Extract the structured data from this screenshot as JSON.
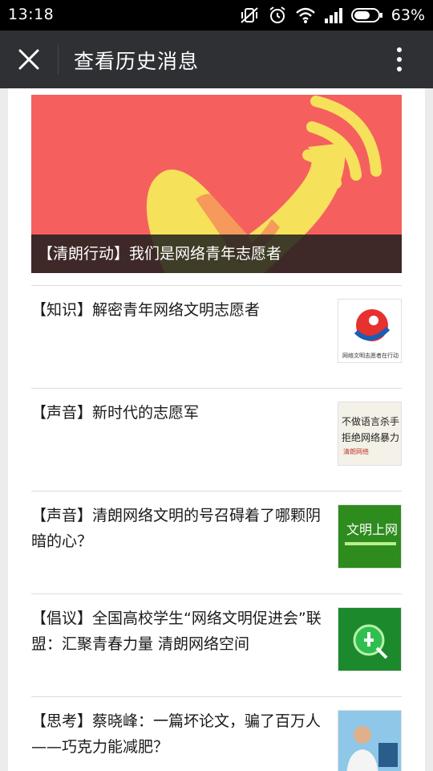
{
  "status_bar": {
    "time": "13:18",
    "battery": "63%"
  },
  "header": {
    "title": "查看历史消息"
  },
  "hero": {
    "caption": "【清朗行动】我们是网络青年志愿者"
  },
  "articles": [
    {
      "title": "【知识】解密青年网络文明志愿者",
      "thumb_text": "网络文明志愿者在行动"
    },
    {
      "title": "【声音】新时代的志愿军",
      "thumb_text": "不做语言杀手 拒绝网络暴力"
    },
    {
      "title": "【声音】清朗网络文明的号召碍着了哪颗阴暗的心？",
      "thumb_text": "文明上网"
    },
    {
      "title": "【倡议】全国高校学生“网络文明促进会”联盟：汇聚青春力量 清朗网络空间",
      "thumb_text": ""
    },
    {
      "title": "【思考】蔡晓峰：一篇坏论文，骗了百万人——巧克力能减肥？",
      "thumb_text": ""
    }
  ],
  "colors": {
    "hero_bg": "#f5605f",
    "heart": "#f6e15a",
    "titlebar": "#2f3033"
  }
}
